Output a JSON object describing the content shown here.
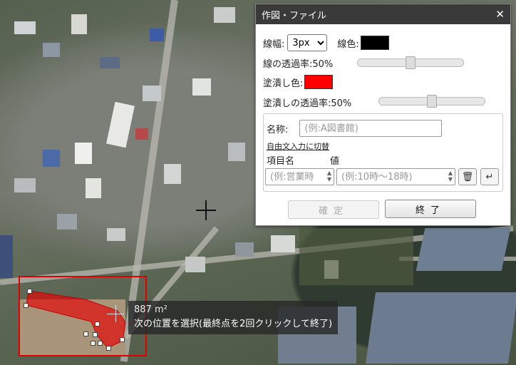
{
  "dialog": {
    "title": "作図・ファイル",
    "close_glyph": "✕",
    "line_width_label": "線幅:",
    "line_width_value": "3px",
    "line_color_label": "線色:",
    "line_color": "#000000",
    "line_opacity_label": "線の透過率:50%",
    "line_opacity": 0.5,
    "fill_color_label": "塗潰し色:",
    "fill_color": "#ff0000",
    "fill_opacity_label": "塗潰しの透過率:50%",
    "fill_opacity": 0.5,
    "name_label": "名称:",
    "name_placeholder": "(例:A図書館)",
    "free_text_link": "自由文入力に切替",
    "item_header": "項目名",
    "value_header": "値",
    "item_placeholder": "(例:営業時",
    "value_placeholder": "(例:10時～18時)",
    "delete_icon_glyph": "🗑",
    "enter_icon_glyph": "↵",
    "confirm_button": "確定",
    "finish_button": "終了"
  },
  "map": {
    "area_readout": "887 m²",
    "instruction": "次の位置を選択(最終点を2回クリックして終了)",
    "selection_color": "#e00000"
  }
}
